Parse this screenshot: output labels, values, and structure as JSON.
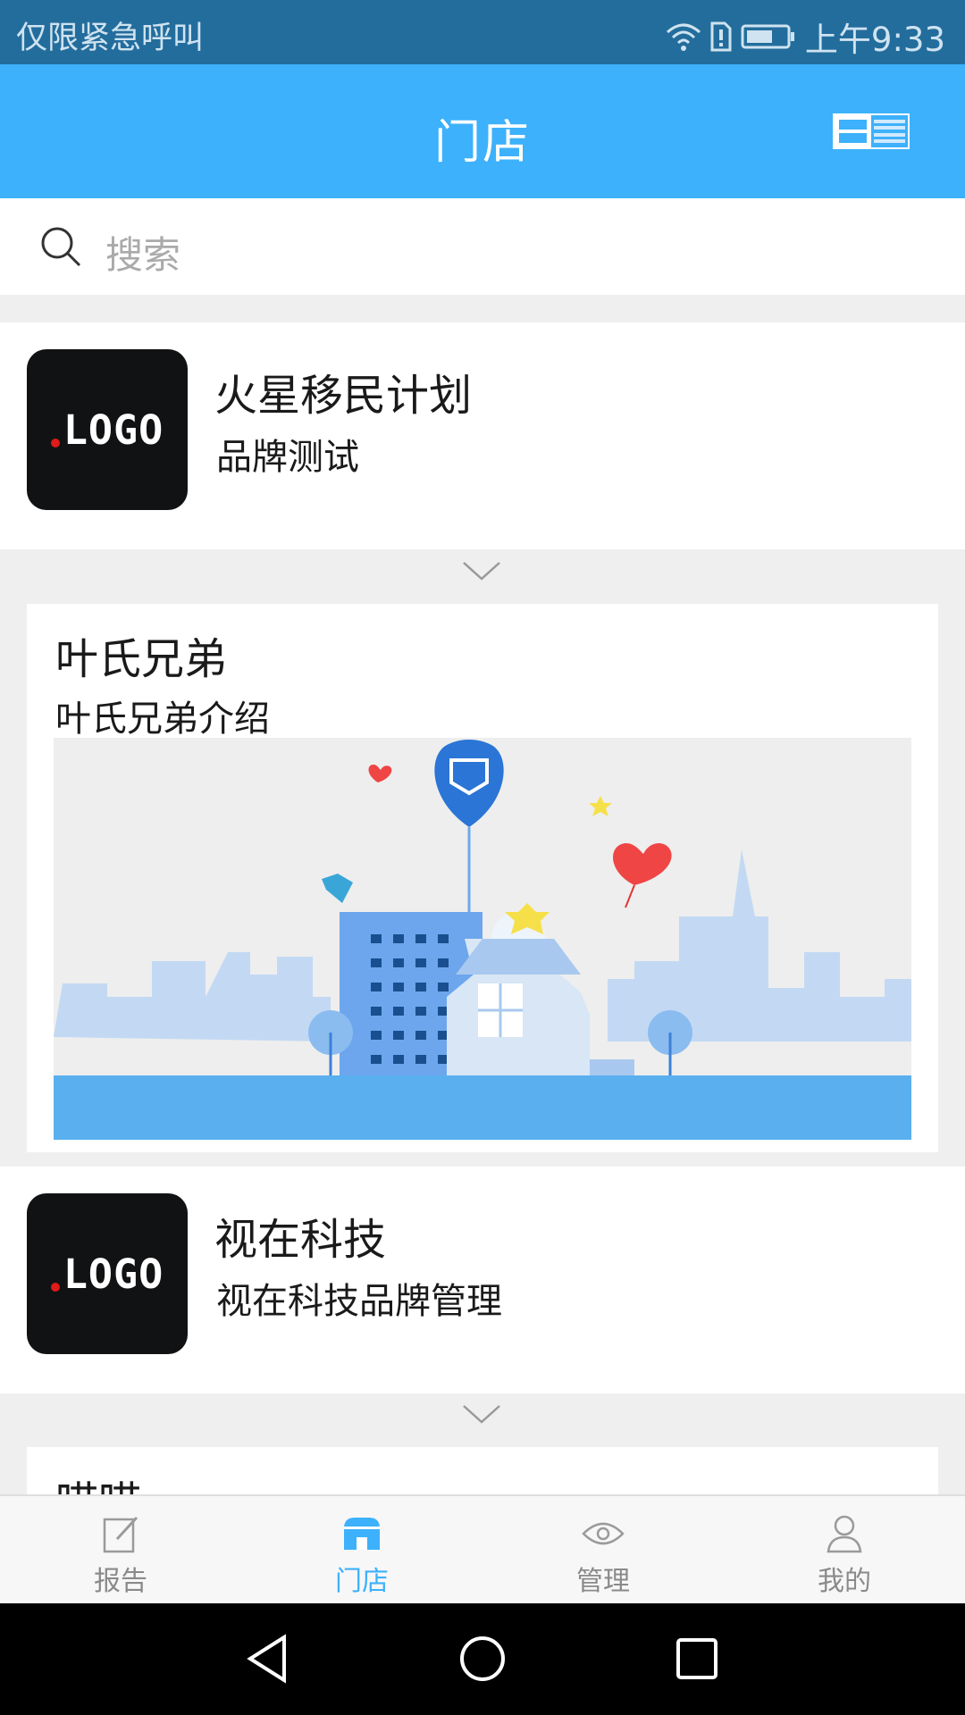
{
  "status": {
    "carrier": "仅限紧急呼叫",
    "time": "上午9:33",
    "icons": [
      "wifi-icon",
      "sim-alert-icon",
      "battery-icon"
    ]
  },
  "header": {
    "title": "门店",
    "view_toggle_icon": "layout-toggle-icon"
  },
  "search": {
    "placeholder": "搜索",
    "icon": "search-icon"
  },
  "stores": [
    {
      "logo_text": "LOGO",
      "name": "火星移民计划",
      "desc": "品牌测试"
    },
    {
      "logo_text": "LOGO",
      "name": "视在科技",
      "desc": "视在科技品牌管理"
    }
  ],
  "promos": [
    {
      "title": "叶氏兄弟",
      "subtitle": "叶氏兄弟介绍",
      "image": "city-illustration"
    },
    {
      "title": "喵喵"
    }
  ],
  "bottom_nav": [
    {
      "label": "报告",
      "icon": "edit-report-icon",
      "active": false
    },
    {
      "label": "门店",
      "icon": "store-icon",
      "active": true
    },
    {
      "label": "管理",
      "icon": "eye-icon",
      "active": false
    },
    {
      "label": "我的",
      "icon": "user-icon",
      "active": false
    }
  ],
  "colors": {
    "accent": "#3db1fb",
    "status_bar": "#236d9d",
    "logo_bg": "#111213",
    "logo_dot": "#e11a1a"
  }
}
